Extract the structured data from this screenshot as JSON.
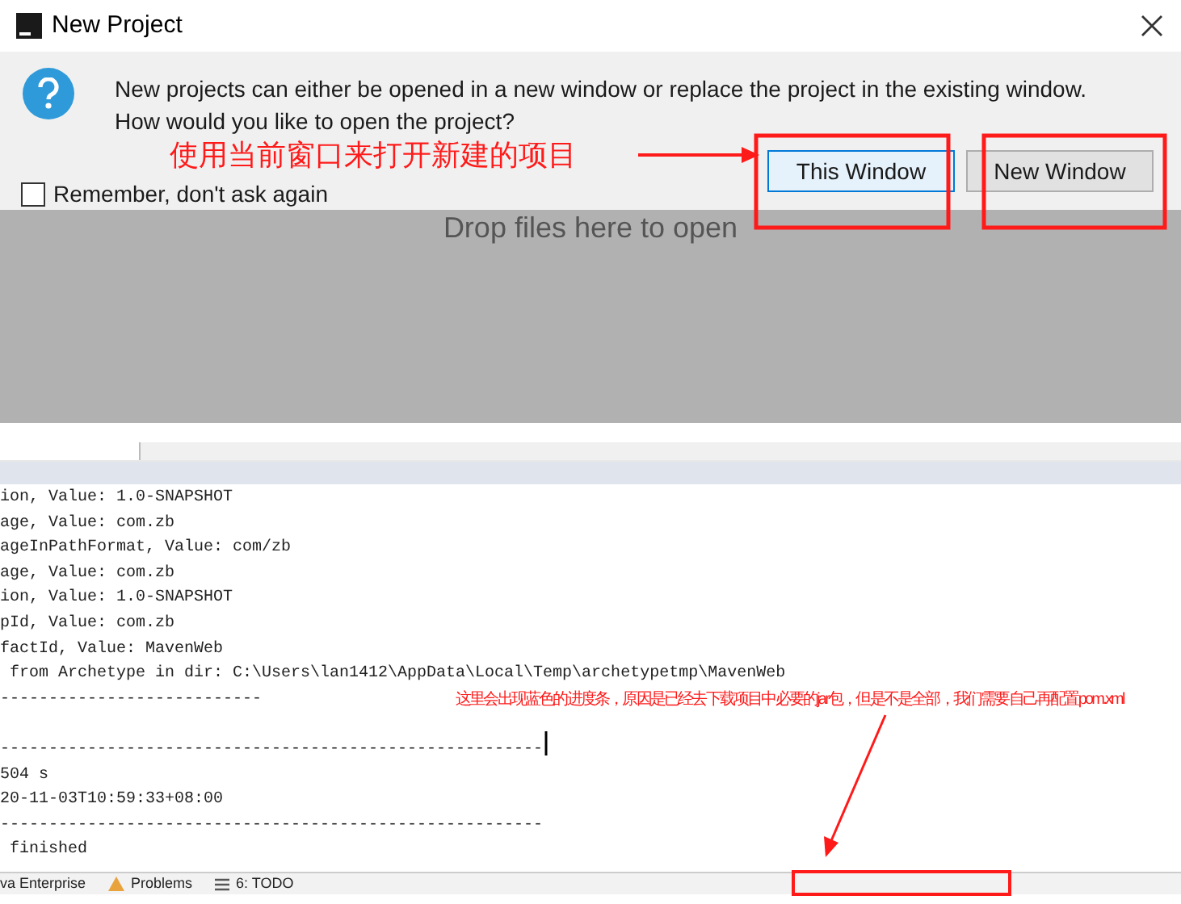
{
  "window": {
    "title": "New Project"
  },
  "dialog": {
    "message": "New projects can either be opened in a new window or replace the project in the existing window.\nHow would you like to open the project?",
    "checkbox": {
      "label": "Remember, don't ask again",
      "checked": false
    },
    "buttons": [
      {
        "label": "This Window",
        "focused": true
      },
      {
        "label": "New Window",
        "focused": false
      }
    ]
  },
  "drop_hint": "Drop files here to open",
  "console": {
    "lines": [
      {
        "text": "ion, Value: 1.0-SNAPSHOT"
      },
      {
        "text": "age, Value: com.zb"
      },
      {
        "text": "ageInPathFormat, Value: com/zb"
      },
      {
        "text": "age, Value: com.zb"
      },
      {
        "text": "ion, Value: 1.0-SNAPSHOT"
      },
      {
        "text": "pId, Value: com.zb"
      },
      {
        "text": "factId, Value: MavenWeb"
      },
      {
        "text": " from Archetype in dir: C:\\Users\\lan1412\\AppData\\Local\\Temp\\archetypetmp\\MavenWeb"
      },
      {
        "text": "---------------------------"
      },
      {
        "text": "--------------------------------------------------------",
        "blank_before": true
      },
      {
        "text": "504 s"
      },
      {
        "text": "20-11-03T10:59:33+08:00"
      },
      {
        "text": "--------------------------------------------------------"
      },
      {
        "text": " finished"
      }
    ]
  },
  "status_bar": [
    {
      "label": "va Enterprise",
      "kind": "plain"
    },
    {
      "label": "Problems",
      "kind": "warning"
    },
    {
      "label": "6: TODO",
      "kind": "list"
    }
  ],
  "annotations": [
    {
      "text": "使用当前窗口来打开新建的项目",
      "kind": "top"
    },
    {
      "text": "这里会出现蓝色的进度条，原因是已经去下载项目中必要的jar包，但是不是全部，我们需要自己再配置pom.xml",
      "kind": "bottom"
    }
  ]
}
